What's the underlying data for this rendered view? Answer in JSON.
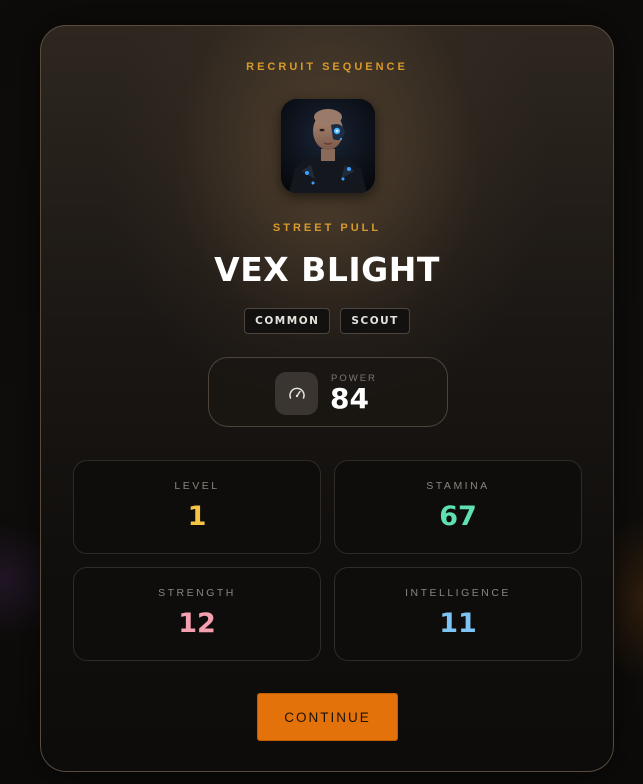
{
  "header": {
    "eyebrow": "RECRUIT SEQUENCE",
    "pull_type": "STREET PULL"
  },
  "character": {
    "name": "VEX BLIGHT",
    "portrait_icon": "cyberpunk-portrait",
    "tags": [
      "COMMON",
      "SCOUT"
    ]
  },
  "power": {
    "label": "POWER",
    "value": "84",
    "icon": "gauge-icon"
  },
  "stats": [
    {
      "label": "LEVEL",
      "value": "1",
      "color": "#f6c443"
    },
    {
      "label": "STAMINA",
      "value": "67",
      "color": "#5fe0b0"
    },
    {
      "label": "STRENGTH",
      "value": "12",
      "color": "#f4a0b0"
    },
    {
      "label": "INTELLIGENCE",
      "value": "11",
      "color": "#7dc4f5"
    }
  ],
  "actions": {
    "continue_label": "CONTINUE"
  },
  "colors": {
    "accent": "#d79a2b",
    "button": "#e4720a"
  }
}
